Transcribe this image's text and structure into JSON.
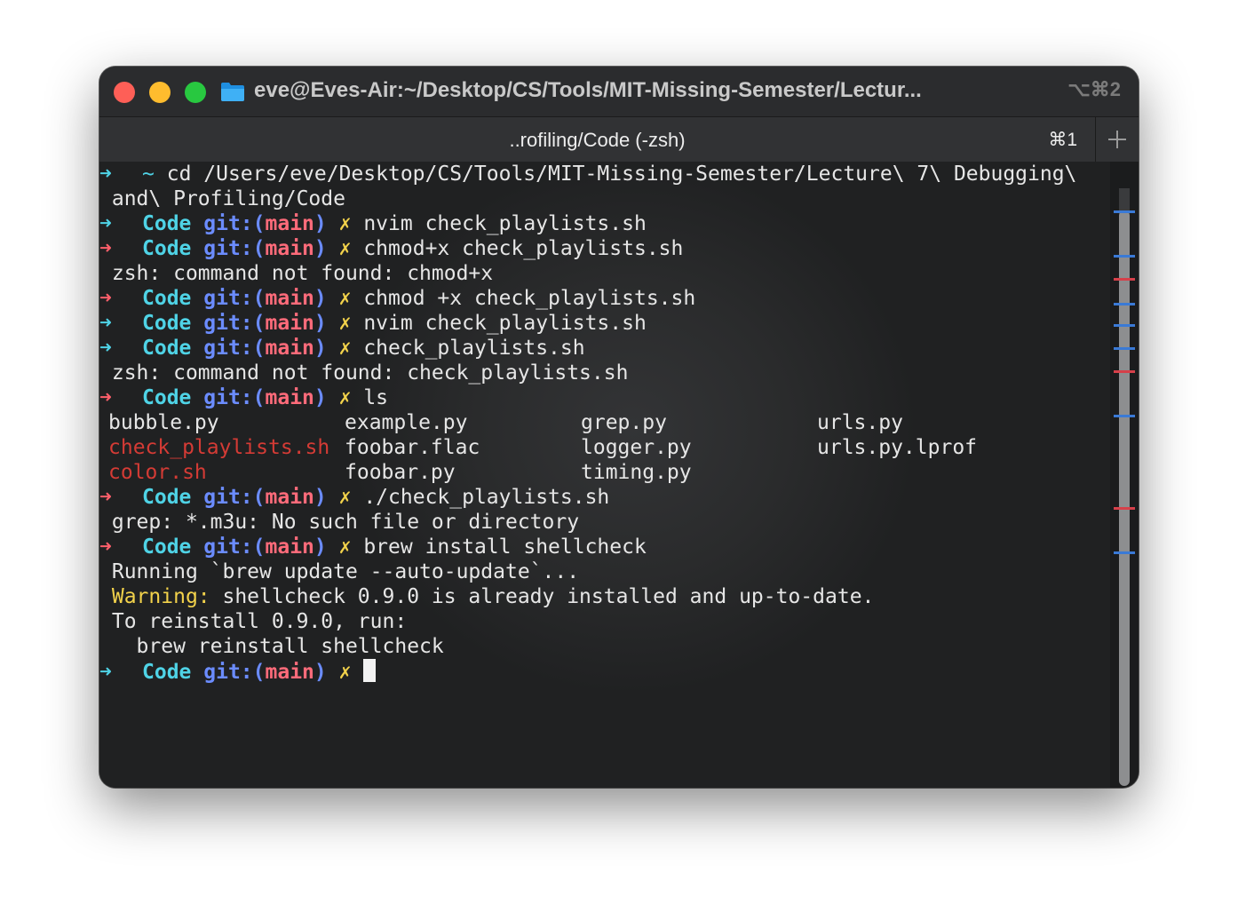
{
  "window": {
    "title": "eve@Eves-Air:~/Desktop/CS/Tools/MIT-Missing-Semester/Lectur...",
    "shortcut": "⌥⌘2"
  },
  "tab": {
    "title": "..rofiling/Code (-zsh)",
    "shortcut": "⌘1",
    "new_tab_icon": "plus-icon"
  },
  "colors": {
    "prompt_arrow_ok": "#4fd3e6",
    "prompt_arrow_err": "#ff5f6b",
    "dir": "#4fd3e6",
    "git": "#6b8cff",
    "branch": "#ff6b7a",
    "dirty_mark": "#f2d24b",
    "warning": "#f2d24b",
    "executable_file": "#d43b35"
  },
  "terminal": {
    "prompt": {
      "arrow": "➜",
      "dir": "Code",
      "git_open": "git:(",
      "branch": "main",
      "git_close": ")",
      "dirty": "✗"
    },
    "line1": {
      "arrow": "➜",
      "tilde": "~",
      "command": "cd /Users/eve/Desktop/CS/Tools/MIT-Missing-Semester/Lecture\\ 7\\ Debugging\\",
      "continuation": "and\\ Profiling/Code"
    },
    "commands": [
      "nvim check_playlists.sh",
      "chmod+x check_playlists.sh",
      "chmod +x check_playlists.sh",
      "nvim check_playlists.sh",
      "check_playlists.sh",
      "ls",
      "./check_playlists.sh",
      "brew install shellcheck"
    ],
    "outputs": {
      "chmod_error": "zsh: command not found: chmod+x",
      "check_error": "zsh: command not found: check_playlists.sh",
      "grep_error": "grep: *.m3u: No such file or directory",
      "brew_running": "Running `brew update --auto-update`...",
      "warning_label": "Warning:",
      "warning_text": " shellcheck 0.9.0 is already installed and up-to-date.",
      "reinstall_hint": "To reinstall 0.9.0, run:",
      "reinstall_cmd": "  brew reinstall shellcheck"
    },
    "ls_rows": [
      [
        "bubble.py",
        "example.py",
        "grep.py",
        "urls.py"
      ],
      [
        "check_playlists.sh",
        "foobar.flac",
        "logger.py",
        "urls.py.lprof"
      ],
      [
        "color.sh",
        "foobar.py",
        "timing.py",
        ""
      ]
    ]
  }
}
